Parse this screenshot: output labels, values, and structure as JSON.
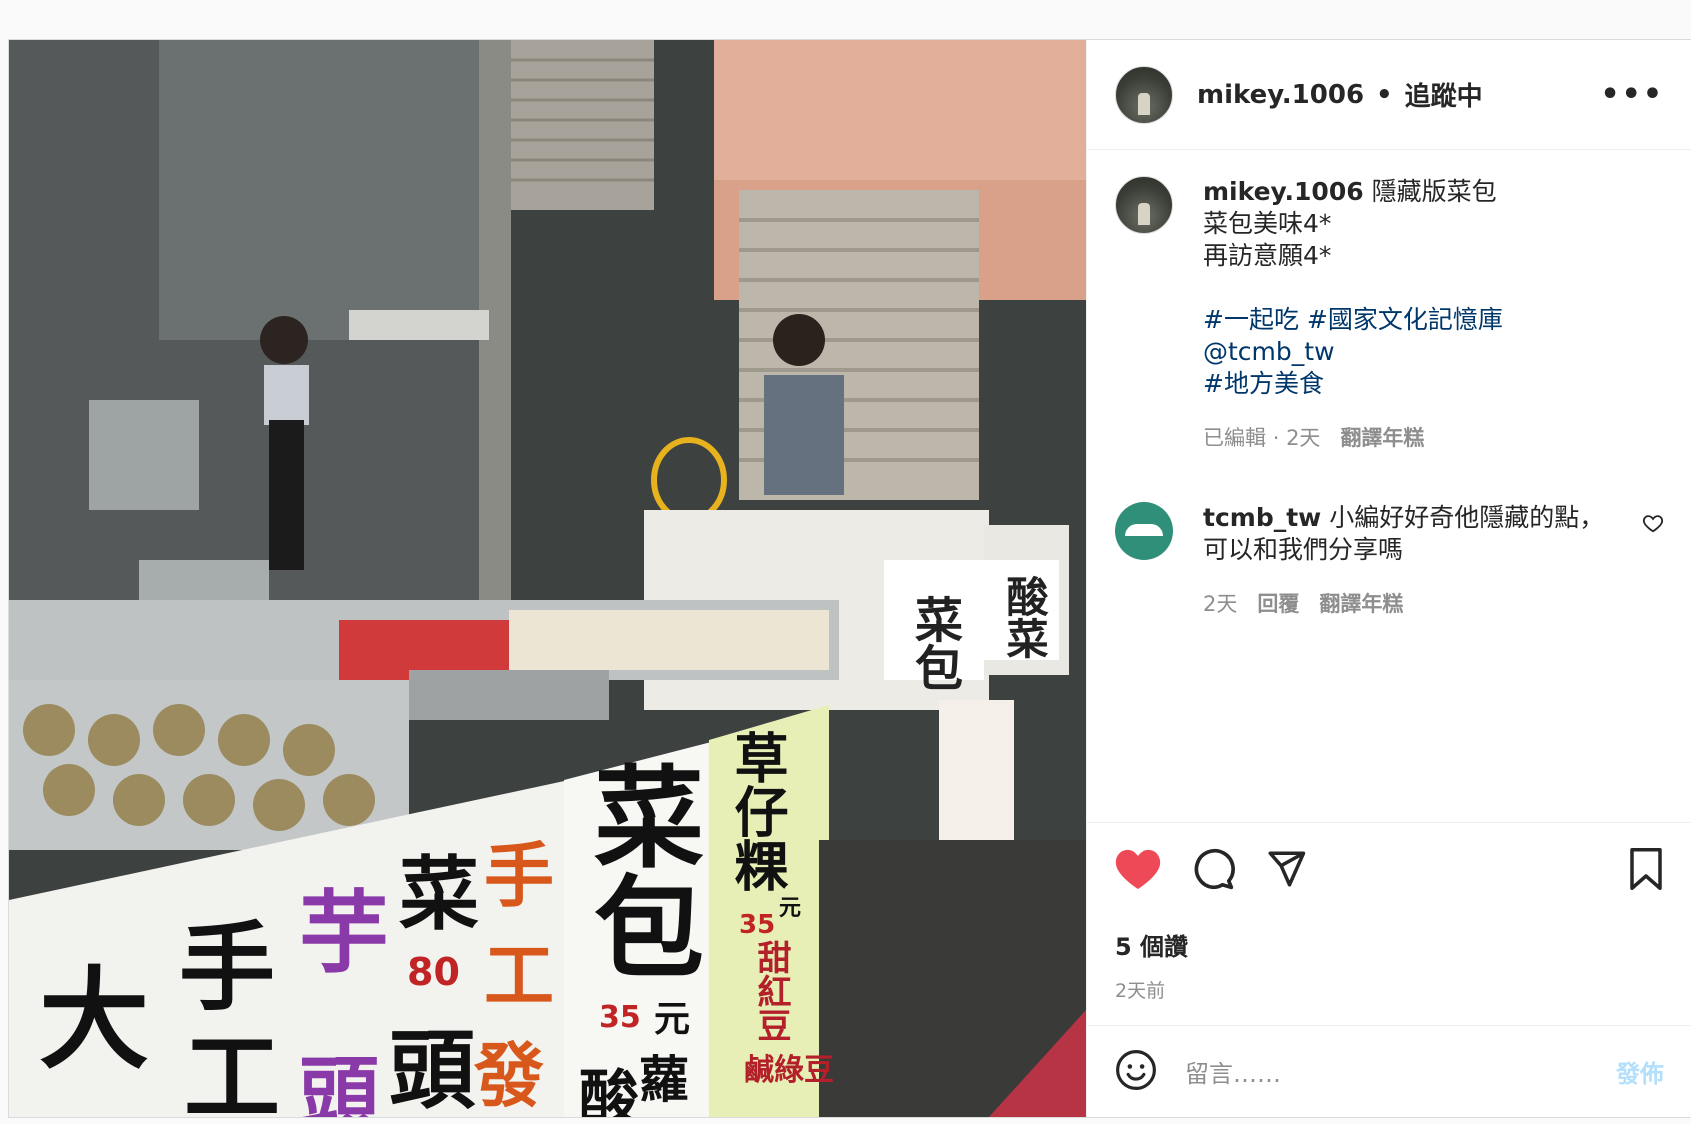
{
  "header": {
    "username": "mikey.1006",
    "separator": "•",
    "follow_state": "追蹤中",
    "more": "•••"
  },
  "caption": {
    "username": "mikey.1006",
    "lines": [
      "隱藏版菜包",
      "菜包美味4*",
      "再訪意願4*"
    ],
    "hashtags": [
      "#一起吃 #國家文化記憶庫",
      "@tcmb_tw",
      "#地方美食"
    ],
    "edited": "已編輯",
    "dot": "·",
    "age": "2天",
    "translate": "翻譯年糕"
  },
  "comment": {
    "username": "tcmb_tw",
    "text": "小編好好奇他隱藏的點，可以和我們分享嗎",
    "age": "2天",
    "reply": "回覆",
    "translate": "翻譯年糕"
  },
  "likes": "5 個讚",
  "posted": "2天前",
  "composer": {
    "placeholder": "留言……",
    "submit": "發佈"
  },
  "photo_signs": {
    "box_left": "菜包",
    "box_right": "酸菜",
    "big_sign": "菜包",
    "price_a": "35",
    "unit_a": "元",
    "green_sign": "草仔粿",
    "green_price": "35",
    "green_unit": "元",
    "left_sign_1": "大",
    "left_sign_2": "手",
    "left_sign_3": "工",
    "purple_1": "芋",
    "purple_2": "頭",
    "black_1": "菜",
    "black_2": "頭",
    "price_b": "80",
    "orange_1": "手",
    "orange_2": "工",
    "orange_3": "發",
    "red_1": "甜紅豆",
    "red_2": "鹹綠豆",
    "bottom_1": "酸",
    "bottom_2": "蘿"
  },
  "colors": {
    "like_red": "#ed4956",
    "link_blue": "#00376b",
    "post_btn": "#b2dffc"
  }
}
